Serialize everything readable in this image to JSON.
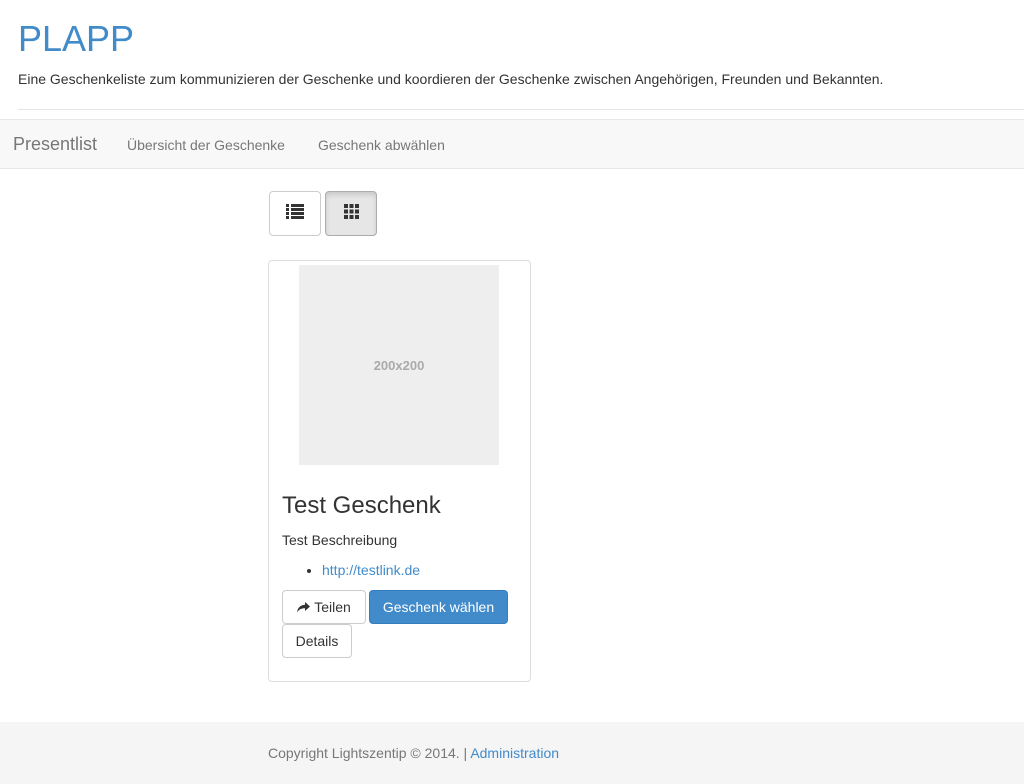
{
  "header": {
    "title": "PLAPP",
    "tagline": "Eine Geschenkeliste zum kommunizieren der Geschenke und koordieren der Geschenke zwischen Angehörigen, Freunden und Bekannten."
  },
  "navbar": {
    "brand": "Presentlist",
    "links": [
      {
        "label": "Übersicht der Geschenke"
      },
      {
        "label": "Geschenk abwählen"
      }
    ]
  },
  "view_toggle": {
    "options": [
      {
        "icon": "list-icon",
        "active": false
      },
      {
        "icon": "grid-icon",
        "active": true
      }
    ]
  },
  "gift": {
    "image_placeholder": "200x200",
    "title": "Test Geschenk",
    "description": "Test Beschreibung",
    "links": [
      "http://testlink.de"
    ],
    "share_label": "Teilen",
    "choose_label": "Geschenk wählen",
    "details_label": "Details"
  },
  "footer": {
    "copyright": "Copyright Lightszentip © 2014. |",
    "admin_link": "Administration"
  },
  "colors": {
    "brand": "#428bca",
    "navbar_bg": "#f8f8f8",
    "footer_bg": "#f5f5f5"
  }
}
